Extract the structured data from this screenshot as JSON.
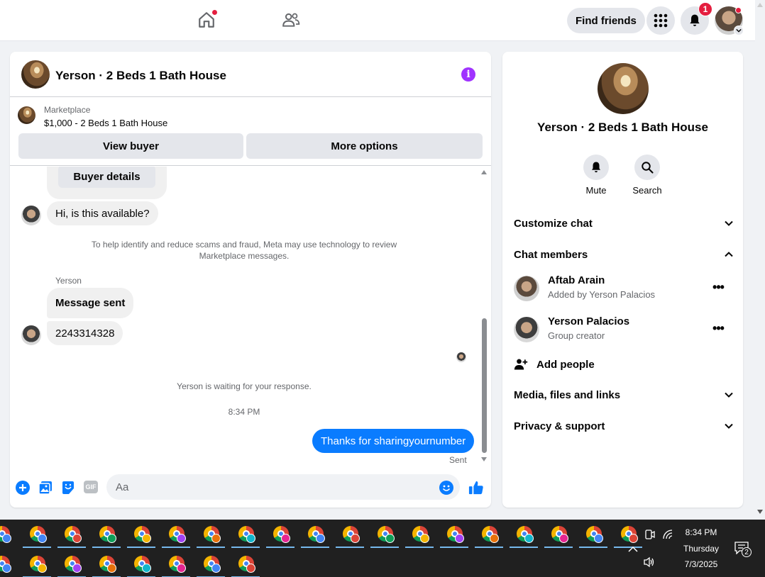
{
  "topbar": {
    "find_friends": "Find friends",
    "notification_count": "1",
    "icons": [
      "home-icon",
      "friends-icon",
      "menu-grid-icon",
      "bell-icon"
    ]
  },
  "chat": {
    "title": "Yerson · 2 Beds 1 Bath House",
    "marketplace_label": "Marketplace",
    "listing": "$1,000 - 2 Beds 1 Bath House",
    "view_buyer": "View buyer",
    "more_options": "More options",
    "buyer_details": "Buyer details",
    "messages": [
      {
        "text": "Hi, is this available?",
        "from": "other"
      },
      {
        "sender": "Yerson",
        "text": "Message sent",
        "from": "other"
      },
      {
        "text": "2243314328",
        "from": "other"
      }
    ],
    "safety_notice": "To help identify and reduce scams and fraud, Meta may use technology to review Marketplace messages.",
    "waiting": "Yerson is waiting for your response.",
    "time": "8:34 PM",
    "sent_message": "Thanks for sharingyournumber",
    "sent_status": "Sent",
    "composer_placeholder": "Aa",
    "gif_label": "GIF"
  },
  "details": {
    "title": "Yerson · 2 Beds 1 Bath House",
    "mute": "Mute",
    "search": "Search",
    "customize_chat": "Customize chat",
    "chat_members": "Chat members",
    "members": [
      {
        "name": "Aftab Arain",
        "subtitle": "Added by Yerson Palacios"
      },
      {
        "name": "Yerson Palacios",
        "subtitle": "Group creator"
      }
    ],
    "add_people": "Add people",
    "media": "Media, files and links",
    "privacy": "Privacy & support"
  },
  "taskbar": {
    "time": "8:34 PM",
    "day": "Thursday",
    "date": "7/3/2025",
    "notification_count": "2"
  },
  "colors": {
    "messenger_blue": "#0a7cff",
    "info_purple": "#a033ff",
    "badge_red": "#e41e3f"
  }
}
